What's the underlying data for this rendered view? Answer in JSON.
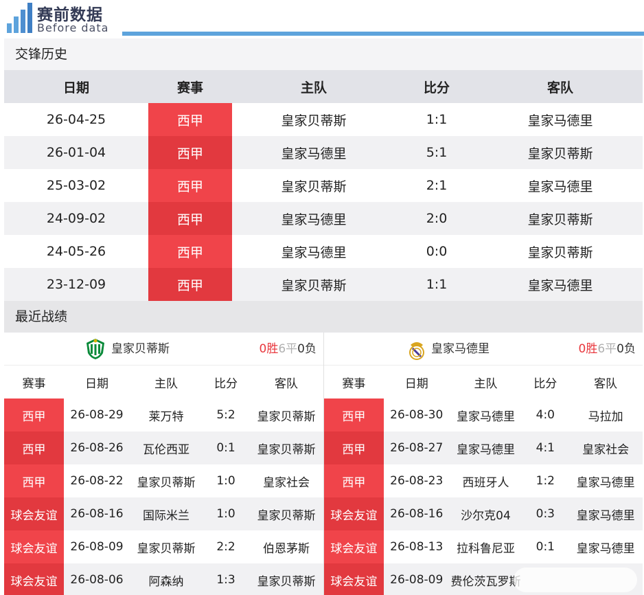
{
  "header": {
    "title": "赛前数据",
    "subtitle": "Before data",
    "accent": "#5da3dc"
  },
  "h2h": {
    "section_title": "交锋历史",
    "columns": [
      "日期",
      "赛事",
      "主队",
      "比分",
      "客队"
    ],
    "rows": [
      {
        "date": "26-04-25",
        "comp": "西甲",
        "home": "皇家贝蒂斯",
        "score": "1:1",
        "away": "皇家马德里"
      },
      {
        "date": "26-01-04",
        "comp": "西甲",
        "home": "皇家马德里",
        "score": "5:1",
        "away": "皇家贝蒂斯"
      },
      {
        "date": "25-03-02",
        "comp": "西甲",
        "home": "皇家贝蒂斯",
        "score": "2:1",
        "away": "皇家马德里"
      },
      {
        "date": "24-09-02",
        "comp": "西甲",
        "home": "皇家马德里",
        "score": "2:0",
        "away": "皇家贝蒂斯"
      },
      {
        "date": "24-05-26",
        "comp": "西甲",
        "home": "皇家马德里",
        "score": "0:0",
        "away": "皇家贝蒂斯"
      },
      {
        "date": "23-12-09",
        "comp": "西甲",
        "home": "皇家贝蒂斯",
        "score": "1:1",
        "away": "皇家马德里"
      }
    ]
  },
  "recent": {
    "section_title": "最近战绩",
    "columns": [
      "赛事",
      "日期",
      "主队",
      "比分",
      "客队"
    ],
    "left": {
      "team": "皇家贝蒂斯",
      "logo": "real-betis-crest-icon",
      "record": {
        "w": "0",
        "w_label": "胜",
        "d": "6",
        "d_label": "平",
        "l": "0",
        "l_label": "负"
      },
      "rows": [
        {
          "comp": "西甲",
          "date": "26-08-29",
          "home": "莱万特",
          "score": "5:2",
          "away": "皇家贝蒂斯"
        },
        {
          "comp": "西甲",
          "date": "26-08-26",
          "home": "瓦伦西亚",
          "score": "0:1",
          "away": "皇家贝蒂斯"
        },
        {
          "comp": "西甲",
          "date": "26-08-22",
          "home": "皇家贝蒂斯",
          "score": "1:0",
          "away": "皇家社会"
        },
        {
          "comp": "球会友谊",
          "date": "26-08-16",
          "home": "国际米兰",
          "score": "1:0",
          "away": "皇家贝蒂斯"
        },
        {
          "comp": "球会友谊",
          "date": "26-08-09",
          "home": "皇家贝蒂斯",
          "score": "2:2",
          "away": "伯恩茅斯"
        },
        {
          "comp": "球会友谊",
          "date": "26-08-06",
          "home": "阿森纳",
          "score": "1:3",
          "away": "皇家贝蒂斯"
        }
      ]
    },
    "right": {
      "team": "皇家马德里",
      "logo": "real-madrid-crest-icon",
      "record": {
        "w": "0",
        "w_label": "胜",
        "d": "6",
        "d_label": "平",
        "l": "0",
        "l_label": "负"
      },
      "rows": [
        {
          "comp": "西甲",
          "date": "26-08-30",
          "home": "皇家马德里",
          "score": "4:0",
          "away": "马拉加"
        },
        {
          "comp": "西甲",
          "date": "26-08-27",
          "home": "皇家马德里",
          "score": "4:1",
          "away": "皇家社会"
        },
        {
          "comp": "西甲",
          "date": "26-08-23",
          "home": "西班牙人",
          "score": "1:2",
          "away": "皇家马德里"
        },
        {
          "comp": "球会友谊",
          "date": "26-08-16",
          "home": "沙尔克04",
          "score": "0:3",
          "away": "皇家马德里"
        },
        {
          "comp": "球会友谊",
          "date": "26-08-13",
          "home": "拉科鲁尼亚",
          "score": "0:1",
          "away": "皇家马德里"
        },
        {
          "comp": "球会友谊",
          "date": "26-08-09",
          "home": "费伦茨瓦罗斯",
          "score": "",
          "away": ""
        }
      ]
    }
  },
  "colors": {
    "competition_red": "#f0444a",
    "win_red": "#e8373d"
  }
}
